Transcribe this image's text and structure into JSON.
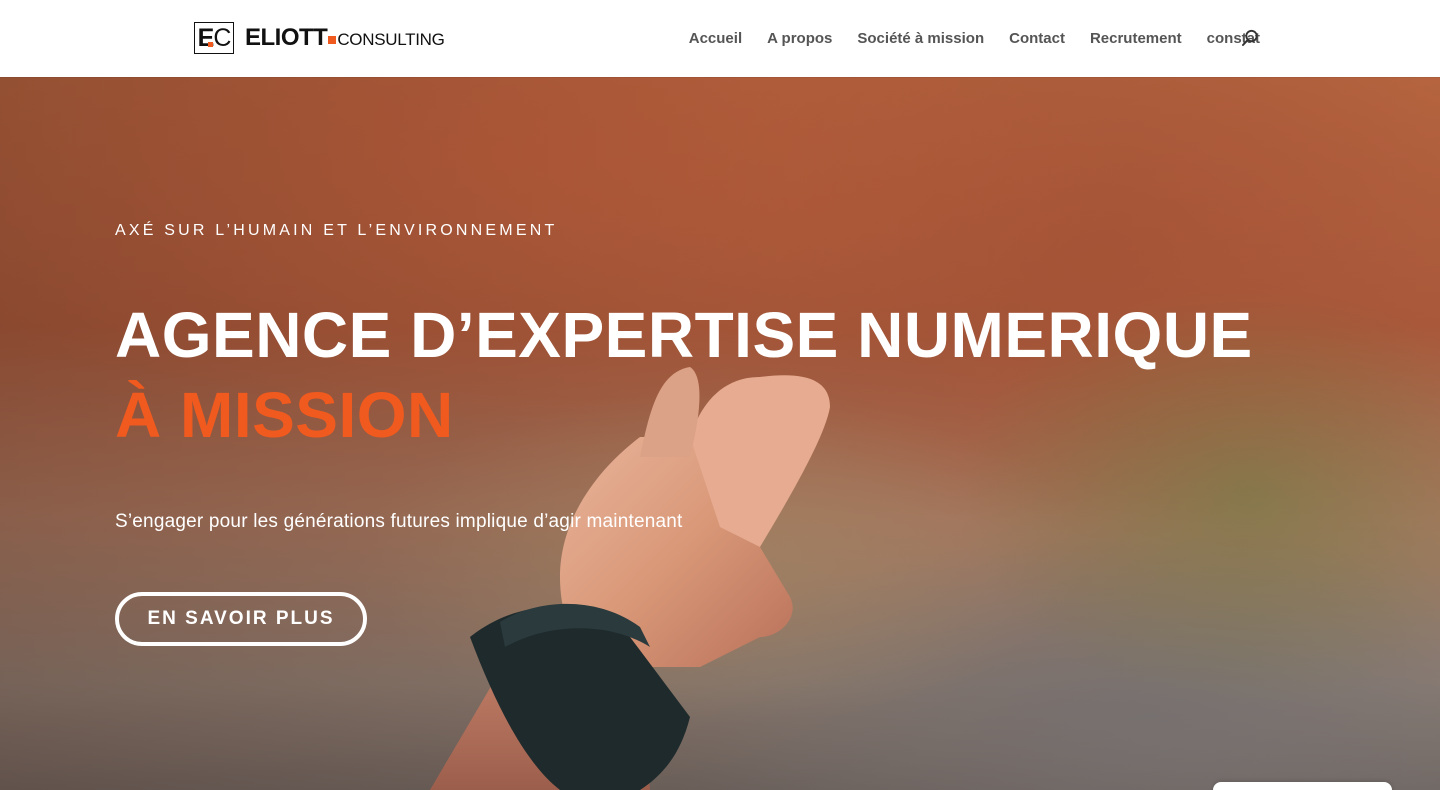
{
  "header": {
    "logo": {
      "mark_e": "E",
      "mark_c": "C",
      "word_strong": "ELIOTT",
      "word_light": "CONSULTING"
    },
    "nav": [
      "Accueil",
      "A propos",
      "Société à mission",
      "Contact",
      "Recrutement",
      "constat"
    ],
    "search_icon": "search-icon"
  },
  "hero": {
    "eyebrow": "AXÉ SUR L’HUMAIN ET L’ENVIRONNEMENT",
    "title_line1": "AGENCE D’EXPERTISE NUMERIQUE",
    "title_line2": "À MISSION",
    "subtitle": "S’engager pour les générations futures implique d’agir maintenant",
    "cta_label": "EN SAVOIR PLUS"
  },
  "colors": {
    "accent": "#f05a1e",
    "nav_text": "#555555",
    "hero_text": "#ffffff"
  }
}
